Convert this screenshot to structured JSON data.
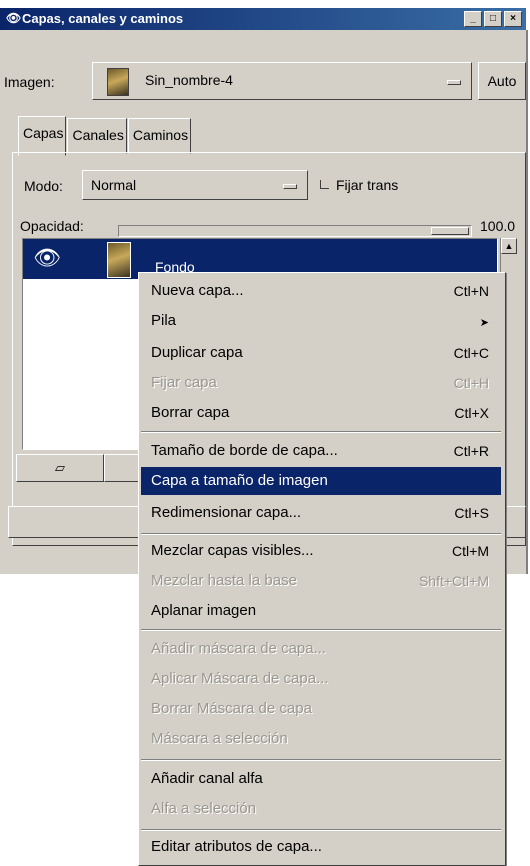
{
  "window": {
    "title": "Capas, canales y caminos",
    "title_icon": "gimp-eye-icon",
    "buttons": [
      "_",
      "□",
      "×"
    ]
  },
  "image_row": {
    "label": "Imagen:",
    "selected": "Sin_nombre-4",
    "auto_label": "Auto"
  },
  "tabs": [
    "Capas",
    "Canales",
    "Caminos"
  ],
  "mode_row": {
    "label": "Modo:",
    "value": "Normal",
    "lock_label": "Fijar trans"
  },
  "opacity": {
    "label": "Opacidad:",
    "value": "100.0",
    "fraction": 1.0
  },
  "layers": [
    {
      "name": "Fondo",
      "visible_icon": "eye-icon"
    }
  ],
  "bottom_buttons": {
    "new_layer_icon": "new-page-icon"
  },
  "context_menu": {
    "items": [
      {
        "label": "Nueva capa...",
        "shortcut": "Ctl+N",
        "disabled": false
      },
      {
        "label": "Pila",
        "shortcut": "",
        "submenu": true,
        "disabled": false
      },
      {
        "label": "Duplicar capa",
        "shortcut": "Ctl+C",
        "disabled": false
      },
      {
        "label": "Fijar capa",
        "shortcut": "Ctl+H",
        "disabled": true
      },
      {
        "label": "Borrar capa",
        "shortcut": "Ctl+X",
        "disabled": false
      },
      {
        "label": "Tamaño de borde de capa...",
        "shortcut": "Ctl+R",
        "disabled": false
      },
      {
        "label": "Capa a tamaño de imagen",
        "shortcut": "",
        "disabled": false,
        "highlighted": true
      },
      {
        "label": "Redimensionar capa...",
        "shortcut": "Ctl+S",
        "disabled": false
      },
      {
        "label": "Mezclar capas visibles...",
        "shortcut": "Ctl+M",
        "disabled": false
      },
      {
        "label": "Mezclar hasta la base",
        "shortcut": "Shft+Ctl+M",
        "disabled": true
      },
      {
        "label": "Aplanar imagen",
        "shortcut": "",
        "disabled": false
      },
      {
        "label": "Añadir máscara de capa...",
        "shortcut": "",
        "disabled": true
      },
      {
        "label": "Aplicar Máscara de capa...",
        "shortcut": "",
        "disabled": true
      },
      {
        "label": "Borrar Máscara de capa",
        "shortcut": "",
        "disabled": true
      },
      {
        "label": "Máscara a selección",
        "shortcut": "",
        "disabled": true
      },
      {
        "label": "Añadir canal alfa",
        "shortcut": "",
        "disabled": false
      },
      {
        "label": "Alfa a selección",
        "shortcut": "",
        "disabled": true
      },
      {
        "label": "Editar atributos de capa...",
        "shortcut": "",
        "disabled": false
      }
    ]
  },
  "colors": {
    "face": "#d4d0c8",
    "selection": "#0a246a",
    "title_gradient_end": "#3a6ea5",
    "disabled_text": "#9a978f"
  }
}
